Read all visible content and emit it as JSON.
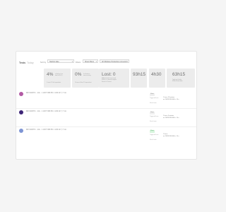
{
  "header": {
    "title": "Tests",
    "subtitle": "Today"
  },
  "filters": [
    {
      "label": "Sort by",
      "value": "Starting date"
    },
    {
      "label": "Filters",
      "value": "Show fillters"
    },
    {
      "label": "",
      "value": "All Shiplane Production connector"
    }
  ],
  "tiles": [
    {
      "big": "4%",
      "small": [
        "of failures (on",
        "total of 0 ch.)"
      ],
      "note": "1 more 2% fail equivalent"
    },
    {
      "big": "0%",
      "small": [
        "0 of failures",
        "non-recurring"
      ],
      "note": "Ot over of flow 2% equivalent"
    },
    {
      "big": "Lost: 0",
      "small": [
        "RPM of Failed connected",
        "SPM in 5 connector pages",
        "Search & Correct"
      ],
      "note": ""
    },
    {
      "big": "93h15",
      "small": [],
      "note": ""
    },
    {
      "big": "4h30",
      "small": [],
      "note": ""
    },
    {
      "big": "63h15",
      "small": [
        "Total and 4 daily",
        "RPM 48 total data"
      ],
      "note": ""
    }
  ],
  "rows": [
    {
      "dot_color": "#b25aa4",
      "meta": "RM 34138Y4 · 1mk · 1 1JDT: 868 8% 1 1/29 217 | 7 min",
      "badge": "Pass",
      "badge_style": "neutral",
      "fields": [
        {
          "label": "Triggered from",
          "value": "1 hours 13 minutes"
        },
        {
          "label": "",
          "value": "on 11/8/2018 08:08 a. 10 n"
        },
        {
          "label": "Result note",
          "value": ""
        }
      ]
    },
    {
      "dot_color": "#3e2577",
      "meta": "RM 34138Y4 · 1mk · 1 1JDT: 868 8% 1 1/29 217 | 7 min",
      "badge": "Pass",
      "badge_style": "neutral",
      "fields": [
        {
          "label": "Triggered from",
          "value": "1 hours 3 minutes"
        },
        {
          "label": "",
          "value": "on 11/8/2018 08:08 a. 10 n"
        },
        {
          "label": "Result note",
          "value": ""
        }
      ]
    },
    {
      "dot_color": "#7e95d4",
      "meta": "RM 34138Y4 · 1mk · 1 1JDT: 868 8% 1 1/29 217 | 7 min",
      "badge": "Pass",
      "badge_style": "green",
      "fields": [
        {
          "label": "Triggered from",
          "value": "1 hours"
        },
        {
          "label": "",
          "value": "on 11/8/2018 08:08 a. 10 n"
        },
        {
          "label": "Result note",
          "value": ""
        }
      ]
    }
  ]
}
